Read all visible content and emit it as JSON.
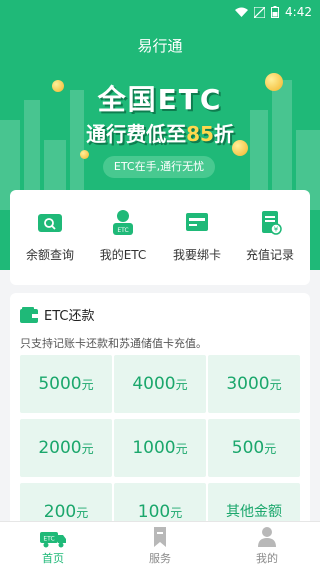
{
  "status_bar": {
    "time": "4:42"
  },
  "header": {
    "title": "易行通"
  },
  "banner": {
    "line1": "全国ETC",
    "line2_prefix": "通行费低至",
    "line2_highlight": "85",
    "line2_suffix": "折",
    "pill": "ETC在手,通行无忧"
  },
  "menu": [
    {
      "label": "余额查询",
      "icon": "balance-query-icon"
    },
    {
      "label": "我的ETC",
      "icon": "my-etc-icon"
    },
    {
      "label": "我要绑卡",
      "icon": "bind-card-icon"
    },
    {
      "label": "充值记录",
      "icon": "recharge-record-icon"
    }
  ],
  "section": {
    "title": "ETC还款",
    "note": "只支持记账卡还款和苏通储值卡充值。",
    "amounts": [
      {
        "value": "5000",
        "unit": "元"
      },
      {
        "value": "4000",
        "unit": "元"
      },
      {
        "value": "3000",
        "unit": "元"
      },
      {
        "value": "2000",
        "unit": "元"
      },
      {
        "value": "1000",
        "unit": "元"
      },
      {
        "value": "500",
        "unit": "元"
      },
      {
        "value": "200",
        "unit": "元"
      },
      {
        "value": "100",
        "unit": "元"
      },
      {
        "value": "其他金额",
        "unit": ""
      }
    ]
  },
  "tabbar": [
    {
      "label": "首页",
      "active": true
    },
    {
      "label": "服务",
      "active": false
    },
    {
      "label": "我的",
      "active": false
    }
  ],
  "colors": {
    "primary": "#1fb978",
    "tile_bg": "#e7f6ef",
    "highlight": "#ffd84d"
  }
}
